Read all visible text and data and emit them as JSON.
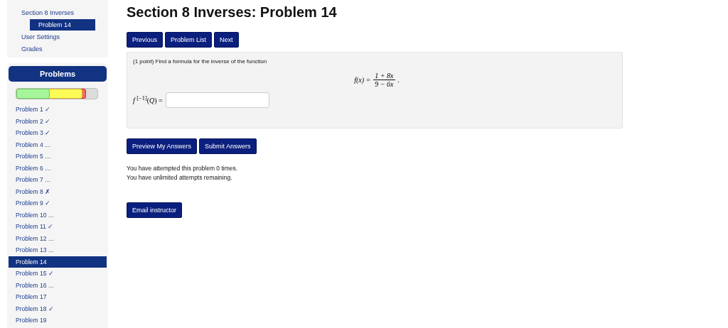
{
  "nav": {
    "items": [
      {
        "label": "Section 8 Inverses",
        "selected": false,
        "children": [
          {
            "label": "Problem 14",
            "selected": true
          }
        ]
      },
      {
        "label": "User Settings",
        "selected": false
      },
      {
        "label": "Grades",
        "selected": false
      }
    ]
  },
  "problems_panel": {
    "title": "Problems",
    "progress": [
      {
        "kind": "correct",
        "level": 0.41
      },
      {
        "kind": "partial",
        "level": 0.82
      },
      {
        "kind": "incorrect",
        "level": 0.86
      }
    ],
    "items": [
      {
        "label": "Problem 1 ✓",
        "selected": false
      },
      {
        "label": "Problem 2 ✓",
        "selected": false
      },
      {
        "label": "Problem 3 ✓",
        "selected": false
      },
      {
        "label": "Problem 4 …",
        "selected": false
      },
      {
        "label": "Problem 5 …",
        "selected": false
      },
      {
        "label": "Problem 6 …",
        "selected": false
      },
      {
        "label": "Problem 7 …",
        "selected": false
      },
      {
        "label": "Problem 8 ✗",
        "selected": false
      },
      {
        "label": "Problem 9 ✓",
        "selected": false
      },
      {
        "label": "Problem 10 …",
        "selected": false
      },
      {
        "label": "Problem 11 ✓",
        "selected": false
      },
      {
        "label": "Problem 12 …",
        "selected": false
      },
      {
        "label": "Problem 13 …",
        "selected": false
      },
      {
        "label": "Problem 14",
        "selected": true
      },
      {
        "label": "Problem 15 ✓",
        "selected": false
      },
      {
        "label": "Problem 16 …",
        "selected": false
      },
      {
        "label": "Problem 17",
        "selected": false
      },
      {
        "label": "Problem 18 ✓",
        "selected": false
      },
      {
        "label": "Problem 19",
        "selected": false
      }
    ]
  },
  "title": "Section 8 Inverses: Problem 14",
  "nav_buttons": [
    "Previous",
    "Problem List",
    "Next"
  ],
  "problem": {
    "prompt": "(1 point) Find a formula for the inverse of the function",
    "formula": {
      "lhs": "*f*(*x*) =",
      "numerator": "1 + 8x",
      "denominator": "9 − 6x",
      "end": "."
    },
    "answer_label": "*f* $^{[−1]}$(*Q*) ="
  },
  "answer_buttons": [
    "Preview My Answers",
    "Submit Answers"
  ],
  "attempts": [
    "You have attempted this problem 0 times.",
    "You have unlimited attempts remaining."
  ],
  "email_button": "Email instructor"
}
